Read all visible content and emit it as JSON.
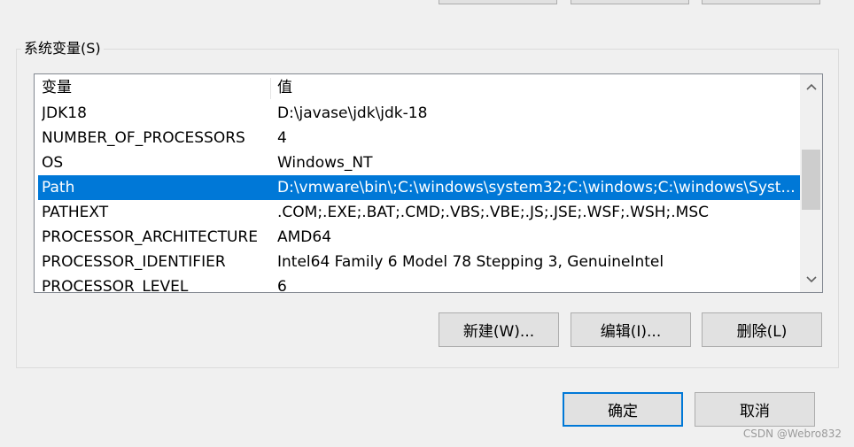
{
  "group": {
    "label": "系统变量(S)"
  },
  "table": {
    "headers": {
      "name": "变量",
      "value": "值"
    },
    "rows": [
      {
        "name": "JDK18",
        "value": "D:\\javase\\jdk\\jdk-18"
      },
      {
        "name": "NUMBER_OF_PROCESSORS",
        "value": "4"
      },
      {
        "name": "OS",
        "value": "Windows_NT"
      },
      {
        "name": "Path",
        "value": "D:\\vmware\\bin\\;C:\\windows\\system32;C:\\windows;C:\\windows\\Syst...",
        "selected": true
      },
      {
        "name": "PATHEXT",
        "value": ".COM;.EXE;.BAT;.CMD;.VBS;.VBE;.JS;.JSE;.WSF;.WSH;.MSC"
      },
      {
        "name": "PROCESSOR_ARCHITECTURE",
        "value": "AMD64"
      },
      {
        "name": "PROCESSOR_IDENTIFIER",
        "value": "Intel64 Family 6 Model 78 Stepping 3, GenuineIntel"
      },
      {
        "name": "PROCESSOR_LEVEL",
        "value": "6"
      }
    ]
  },
  "actions": {
    "new": "新建(W)...",
    "edit": "编辑(I)...",
    "delete": "删除(L)"
  },
  "dialog": {
    "ok": "确定",
    "cancel": "取消"
  },
  "watermark": "CSDN @Webro832",
  "colors": {
    "selection": "#0078d7",
    "default_button_border": "#0078d7",
    "background": "#f0f0f0"
  },
  "icons": {
    "scroll_up": "chevron-up-icon",
    "scroll_down": "chevron-down-icon"
  }
}
